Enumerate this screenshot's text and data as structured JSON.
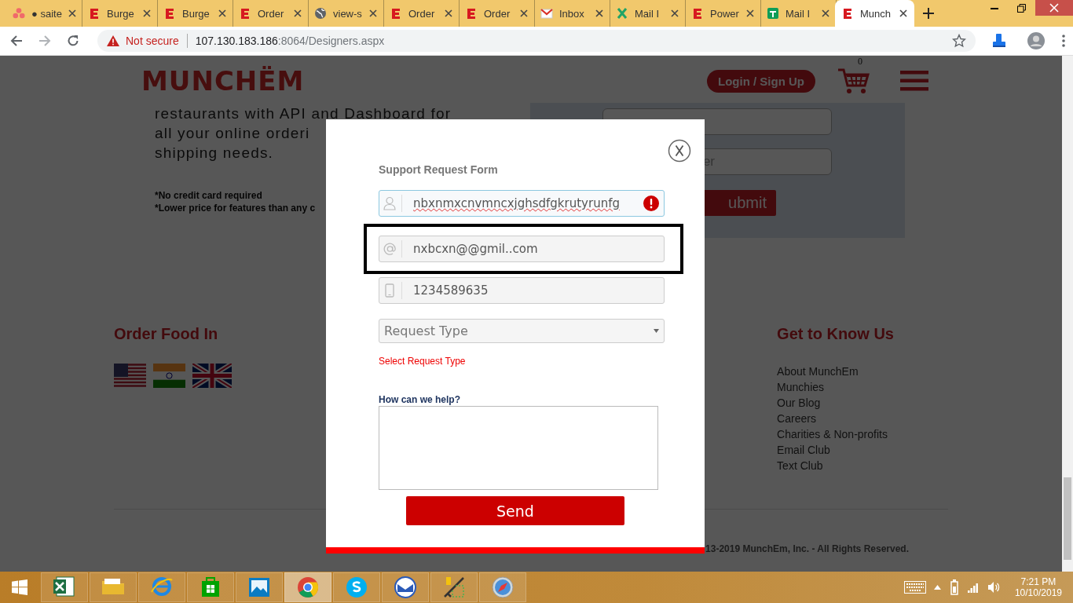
{
  "browser": {
    "tabs": [
      {
        "label": "● saite",
        "kind": "dots",
        "selected": false
      },
      {
        "label": "Burge",
        "kind": "logo",
        "selected": false
      },
      {
        "label": "Burge",
        "kind": "logo",
        "selected": false
      },
      {
        "label": "Order",
        "kind": "logo",
        "selected": false
      },
      {
        "label": "view-s",
        "kind": "globe",
        "selected": false
      },
      {
        "label": "Order",
        "kind": "logo",
        "selected": false
      },
      {
        "label": "Order",
        "kind": "logo",
        "selected": false
      },
      {
        "label": "Inbox",
        "kind": "envelope",
        "selected": false
      },
      {
        "label": "Mail I",
        "kind": "cross",
        "selected": false
      },
      {
        "label": "Power",
        "kind": "logo",
        "selected": false
      },
      {
        "label": "Mail I",
        "kind": "sheet",
        "selected": false
      },
      {
        "label": "Munch",
        "kind": "logo",
        "selected": true
      }
    ],
    "nav": [
      {
        "kind": "back",
        "disabled": false
      },
      {
        "kind": "forward",
        "disabled": true
      },
      {
        "kind": "reload",
        "disabled": false
      }
    ],
    "address": {
      "security": "Not secure",
      "host": "107.130.183.186",
      "path": ":8064/Designers.aspx"
    }
  },
  "page": {
    "logo": "MUNCHËM",
    "login": "Login / Sign Up",
    "cart_count": "0",
    "hero_lines": [
      "restaurants with API and Dashboard for",
      "all your online orderi",
      "shipping needs."
    ],
    "notes": [
      "*No credit card required",
      "*Lower price for features than any c"
    ],
    "signup": {
      "placeholder": "er",
      "button": "ubmit"
    },
    "footer": {
      "left_heading": "Order Food In",
      "right_heading": "Get to Know Us",
      "links": [
        "About MunchEm",
        "Munchies",
        "Our Blog",
        "Careers",
        "Charities & Non-profits",
        "Email Club",
        "Text Club"
      ],
      "copyright": "13-2019 MunchEm, Inc. - All Rights Reserved."
    }
  },
  "modal": {
    "title": "Support Request Form",
    "fields": [
      {
        "kind": "name",
        "value": "nbxnmxcnvmncxjghsdfgkrutyrunfg",
        "error": true,
        "highlighted": false
      },
      {
        "kind": "email",
        "value": "nxbcxn@@gmil..com",
        "error": false,
        "highlighted": true
      },
      {
        "kind": "phone",
        "value": "1234589635",
        "error": false,
        "highlighted": false
      }
    ],
    "select": {
      "placeholder": "Request Type"
    },
    "select_error": "Select Request Type",
    "help_label": "How can we help?",
    "send": "Send"
  },
  "taskbar": {
    "apps": [
      {
        "kind": "spreadsheet",
        "active": false
      },
      {
        "kind": "folder",
        "active": false
      },
      {
        "kind": "browser-e",
        "active": false
      },
      {
        "kind": "store",
        "active": false
      },
      {
        "kind": "picture",
        "active": false
      },
      {
        "kind": "browser",
        "active": true
      },
      {
        "kind": "chat",
        "active": false
      },
      {
        "kind": "mail",
        "active": false
      },
      {
        "kind": "tools",
        "active": false
      },
      {
        "kind": "compass",
        "active": false
      }
    ],
    "time": "7:21 PM",
    "date": "10/10/2019"
  }
}
